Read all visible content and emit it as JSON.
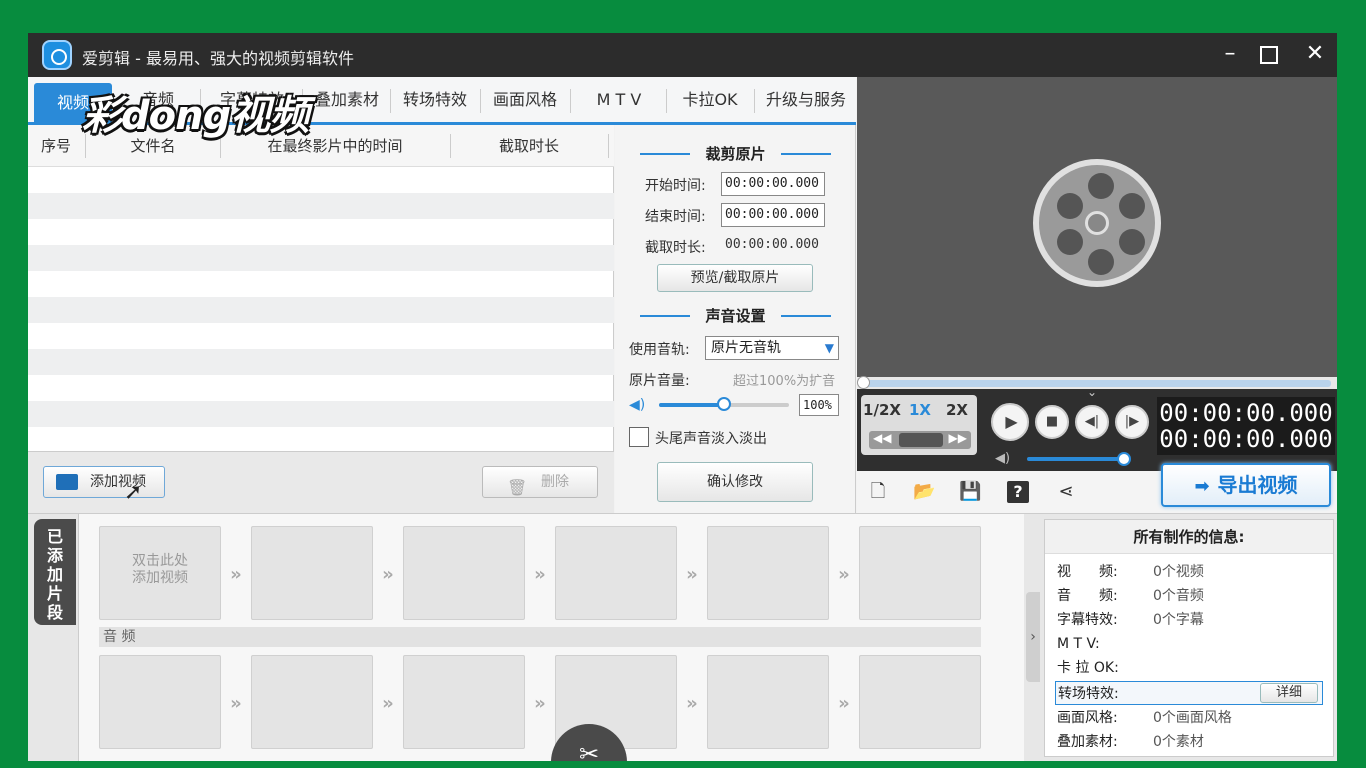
{
  "app": {
    "title": "爱剪辑 - 最易用、强大的视频剪辑软件",
    "watermark": "彩dong视频"
  },
  "tabs": [
    {
      "label": "视频",
      "active": true
    },
    {
      "label": "音频"
    },
    {
      "label": "字幕特效"
    },
    {
      "label": "叠加素材"
    },
    {
      "label": "转场特效"
    },
    {
      "label": "画面风格"
    },
    {
      "label": "M T V"
    },
    {
      "label": "卡拉OK"
    },
    {
      "label": "升级与服务"
    }
  ],
  "file_list": {
    "columns": [
      "序号",
      "文件名",
      "在最终影片中的时间",
      "截取时长"
    ],
    "rows": []
  },
  "buttons": {
    "add_video": "添加视频",
    "delete": "删除",
    "preview_cut": "预览/截取原片",
    "confirm": "确认修改",
    "export": "导出视频",
    "detail": "详细"
  },
  "clip_panel": {
    "title": "裁剪原片",
    "start_label": "开始时间:",
    "start_value": "00:00:00.000",
    "end_label": "结束时间:",
    "end_value": "00:00:00.000",
    "duration_label": "截取时长:",
    "duration_value": "00:00:00.000"
  },
  "sound_panel": {
    "title": "声音设置",
    "track_label": "使用音轨:",
    "track_value": "原片无音轨",
    "volume_label": "原片音量:",
    "volume_hint": "超过100%为扩音",
    "volume_value": "100%",
    "fade_label": "头尾声音淡入淡出"
  },
  "player": {
    "speed_options": [
      "1/2X",
      "1X",
      "2X"
    ],
    "speed_selected": "1X",
    "time_current": "00:00:00.000",
    "time_total": "00:00:00.000"
  },
  "timeline": {
    "sidetab": "已添加片段",
    "first_slot": "双击此处\n添加视频",
    "audio_label": "音 频"
  },
  "info_panel": {
    "title": "所有制作的信息:",
    "rows": [
      {
        "label": "视　　频:",
        "value": "0个视频"
      },
      {
        "label": "音　　频:",
        "value": "0个音频"
      },
      {
        "label": "字幕特效:",
        "value": "0个字幕"
      },
      {
        "label": "M  T  V:",
        "value": ""
      },
      {
        "label": "卡 拉 OK:",
        "value": ""
      },
      {
        "label": "转场特效:",
        "value": ""
      },
      {
        "label": "画面风格:",
        "value": "0个画面风格"
      },
      {
        "label": "叠加素材:",
        "value": "0个素材"
      }
    ]
  }
}
